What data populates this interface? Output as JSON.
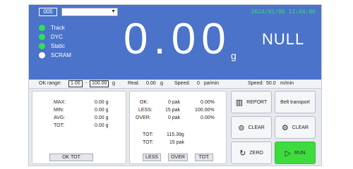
{
  "header": {
    "id_box": "005",
    "dropdown_value": "",
    "datetime": "2024/01/06 13:44:06"
  },
  "status": [
    {
      "label": "Track",
      "color": "#2fe05a"
    },
    {
      "label": "DYC",
      "color": "#2fe05a"
    },
    {
      "label": "Static",
      "color": "#2fe05a"
    },
    {
      "label": "SCRAM",
      "color": "#ffffff"
    }
  ],
  "display": {
    "weight": "0.00",
    "unit": "g",
    "status_text": "NULL"
  },
  "infobar": {
    "ok_range_label": "OK range:",
    "ok_min": "1.00",
    "dash": "-",
    "ok_max": "100.00",
    "ok_unit": "g",
    "real_label": "Real:",
    "real_value": "0.00",
    "real_unit": "g",
    "speed_label": "Speed:",
    "speed_value": "0",
    "speed_unit": "pa/min",
    "speed2_label": "Speed:",
    "speed2_value": "50.0",
    "speed2_unit": "m/min"
  },
  "stats": {
    "max_label": "MAX:",
    "max_value": "0.00 g",
    "min_label": "MIN:",
    "min_value": "0.00 g",
    "avg_label": "AVG:",
    "avg_value": "0.00 g",
    "tot_label": "TOT:",
    "tot_value": "0.00 g",
    "ok_tot_button": "OK TOT"
  },
  "counts": {
    "ok_label": "OK:",
    "ok_pak": "0 pak",
    "ok_pct": "0.00%",
    "less_label": "LESS:",
    "less_pak": "15 pak",
    "less_pct": "100.00%",
    "over_label": "OVER:",
    "over_pak": "0 pak",
    "over_pct": "0.00%",
    "tot_weight_label": "TOT:",
    "tot_weight": "115.39g",
    "tot_pak_label": "TOT:",
    "tot_pak": "15 pak",
    "less_button": "LESS",
    "over_button": "OVER",
    "tot_button": "TOT:"
  },
  "controls": {
    "report": "REPORT",
    "belt_transport": "Belt transport",
    "clear1": "CLEAR",
    "clear2": "CLEAR",
    "zero": "ZERO",
    "run": "RUN"
  }
}
